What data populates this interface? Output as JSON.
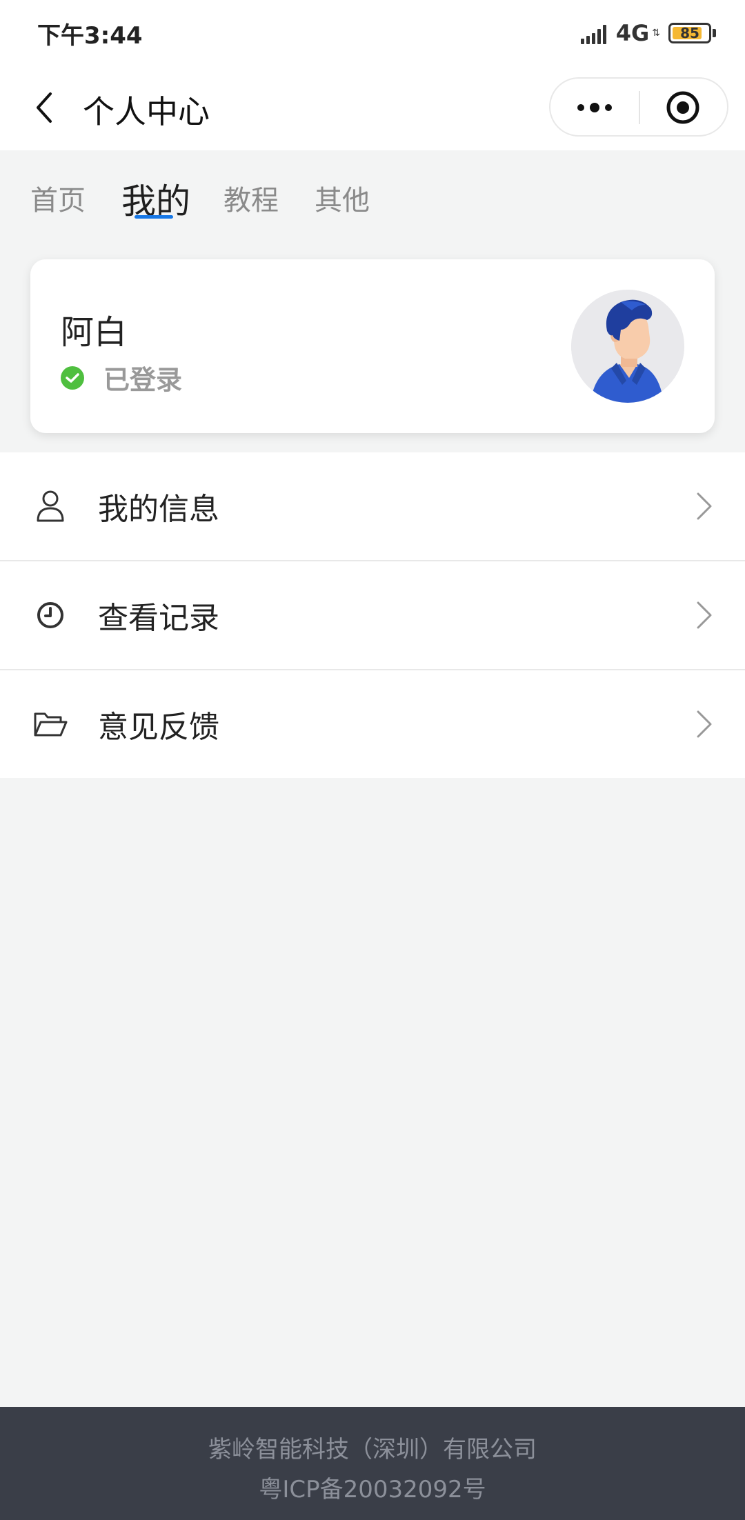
{
  "status_bar": {
    "time": "下午3:44",
    "network": "4G",
    "battery": "85",
    "battery_level": 0.85
  },
  "nav": {
    "title": "个人中心"
  },
  "tabs": [
    {
      "label": "首页",
      "active": false
    },
    {
      "label": "我的",
      "active": true
    },
    {
      "label": "教程",
      "active": false
    },
    {
      "label": "其他",
      "active": false
    }
  ],
  "profile": {
    "name": "阿白",
    "status": "已登录"
  },
  "menu": [
    {
      "label": "我的信息",
      "icon": "user-icon"
    },
    {
      "label": "查看记录",
      "icon": "clock-icon"
    },
    {
      "label": "意见反馈",
      "icon": "folder-open-icon"
    }
  ],
  "footer": {
    "company": "紫岭智能科技（深圳）有限公司",
    "icp": "粤ICP备20032092号"
  },
  "colors": {
    "accent": "#1677e6",
    "success": "#4fbf3f",
    "footer_bg": "#3a3e48"
  }
}
